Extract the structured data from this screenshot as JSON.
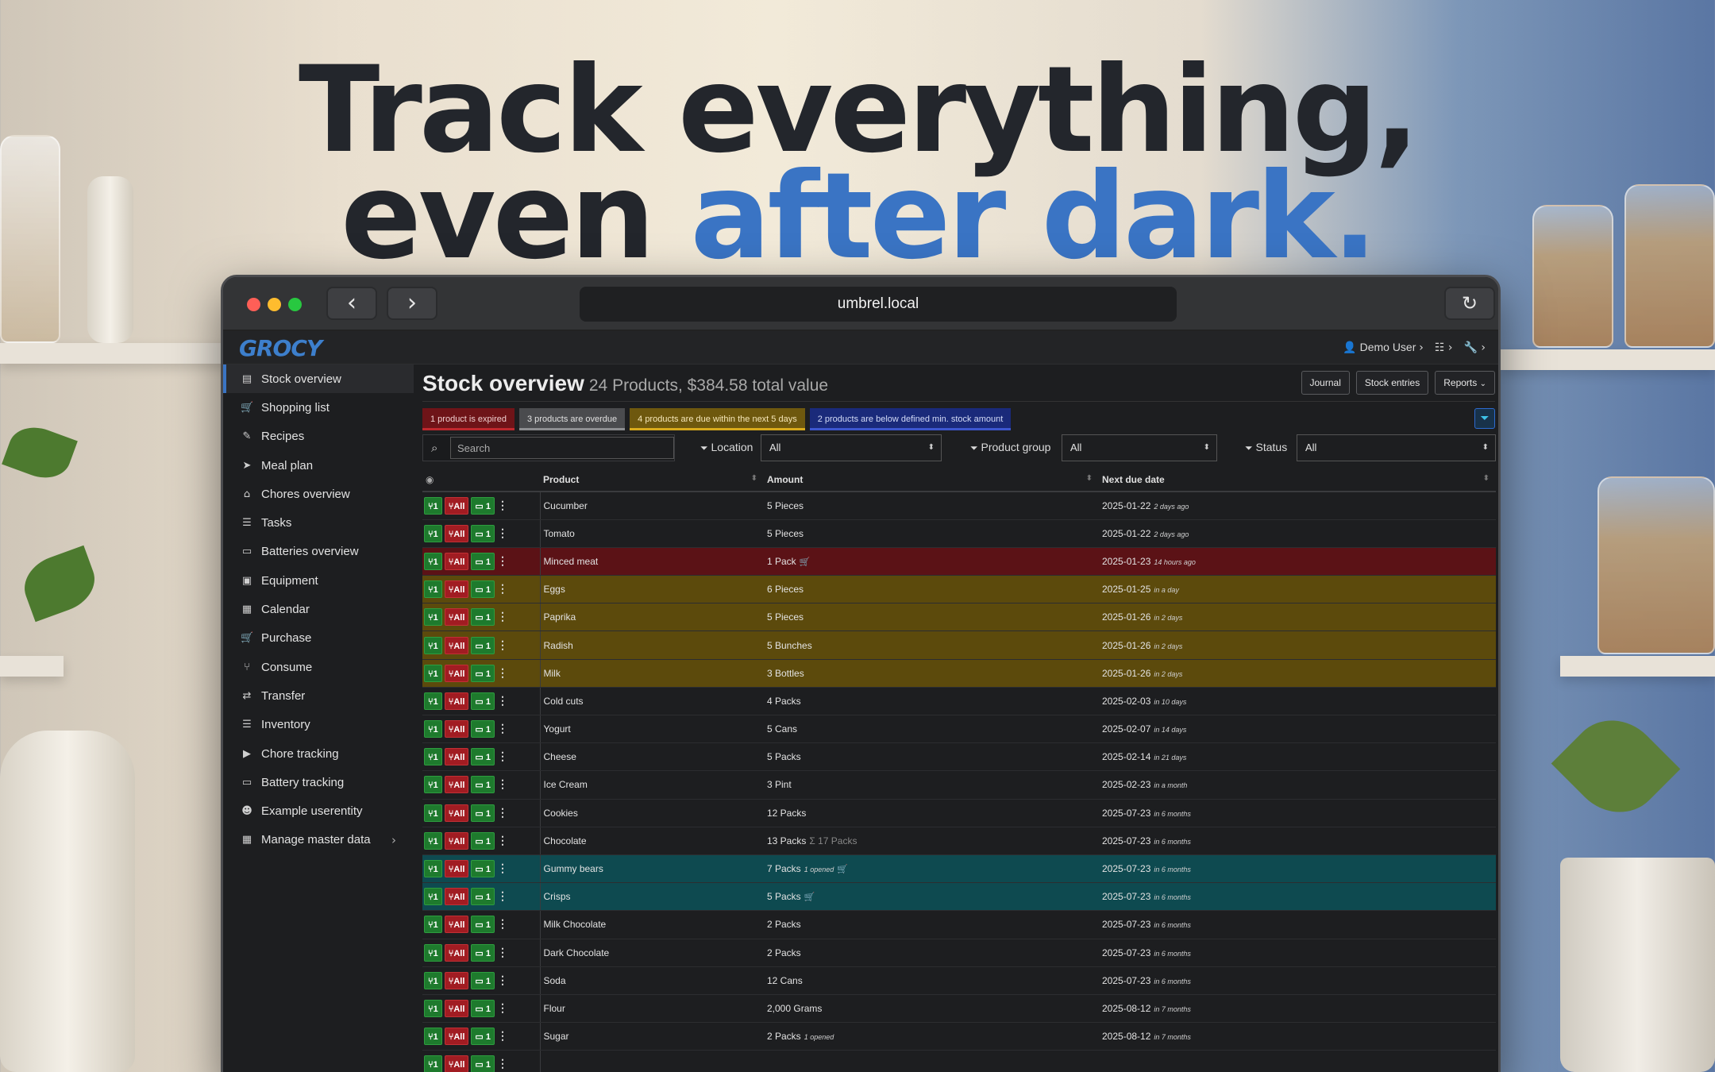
{
  "hero": {
    "line1": "Track everything,",
    "line2_prefix": "even ",
    "line2_accent": "after dark."
  },
  "browser": {
    "url": "umbrel.local",
    "back_icon": "chevron-left-icon",
    "forward_icon": "chevron-right-icon",
    "reload_icon": "reload-icon"
  },
  "app": {
    "logo": "GROCY",
    "user": "Demo User",
    "title": "Stock overview",
    "subtitle": "24 Products, $384.58 total value",
    "buttons": {
      "journal": "Journal",
      "stock_entries": "Stock entries",
      "reports": "Reports"
    }
  },
  "sidebar": {
    "items": [
      {
        "label": "Stock overview",
        "icon": "▤"
      },
      {
        "label": "Shopping list",
        "icon": "🛒"
      },
      {
        "label": "Recipes",
        "icon": "✎"
      },
      {
        "label": "Meal plan",
        "icon": "➤"
      },
      {
        "label": "Chores overview",
        "icon": "⌂"
      },
      {
        "label": "Tasks",
        "icon": "☰"
      },
      {
        "label": "Batteries overview",
        "icon": "▭"
      },
      {
        "label": "Equipment",
        "icon": "▣"
      },
      {
        "label": "Calendar",
        "icon": "▦"
      },
      {
        "label": "Purchase",
        "icon": "🛒"
      },
      {
        "label": "Consume",
        "icon": "⑂"
      },
      {
        "label": "Transfer",
        "icon": "⇄"
      },
      {
        "label": "Inventory",
        "icon": "☰"
      },
      {
        "label": "Chore tracking",
        "icon": "▶"
      },
      {
        "label": "Battery tracking",
        "icon": "▭"
      },
      {
        "label": "Example userentity",
        "icon": "☻"
      },
      {
        "label": "Manage master data",
        "icon": "▦"
      }
    ]
  },
  "alerts": {
    "expired": "1 product is expired",
    "overdue": "3 products are overdue",
    "due_soon": "4 products are due within the next 5 days",
    "below_min": "2 products are below defined min. stock amount"
  },
  "filters": {
    "search_placeholder": "Search",
    "location_label": "Location",
    "location_value": "All",
    "group_label": "Product group",
    "group_value": "All",
    "status_label": "Status",
    "status_value": "All"
  },
  "table": {
    "headers": {
      "product": "Product",
      "amount": "Amount",
      "next_due": "Next due date"
    },
    "action_labels": {
      "consume_one": "1",
      "consume_all": "All",
      "open_one": "1"
    },
    "rows": [
      {
        "product": "Cucumber",
        "amount": "5 Pieces",
        "amount_note": "",
        "opened": "",
        "cart": false,
        "date": "2025-01-22",
        "rel": "2 days ago",
        "status": ""
      },
      {
        "product": "Tomato",
        "amount": "5 Pieces",
        "amount_note": "",
        "opened": "",
        "cart": false,
        "date": "2025-01-22",
        "rel": "2 days ago",
        "status": ""
      },
      {
        "product": "Minced meat",
        "amount": "1 Pack",
        "amount_note": "",
        "opened": "",
        "cart": true,
        "date": "2025-01-23",
        "rel": "14 hours ago",
        "status": "expired"
      },
      {
        "product": "Eggs",
        "amount": "6 Pieces",
        "amount_note": "",
        "opened": "",
        "cart": false,
        "date": "2025-01-25",
        "rel": "in a day",
        "status": "due"
      },
      {
        "product": "Paprika",
        "amount": "5 Pieces",
        "amount_note": "",
        "opened": "",
        "cart": false,
        "date": "2025-01-26",
        "rel": "in 2 days",
        "status": "due"
      },
      {
        "product": "Radish",
        "amount": "5 Bunches",
        "amount_note": "",
        "opened": "",
        "cart": false,
        "date": "2025-01-26",
        "rel": "in 2 days",
        "status": "due"
      },
      {
        "product": "Milk",
        "amount": "3 Bottles",
        "amount_note": "",
        "opened": "",
        "cart": false,
        "date": "2025-01-26",
        "rel": "in 2 days",
        "status": "due"
      },
      {
        "product": "Cold cuts",
        "amount": "4 Packs",
        "amount_note": "",
        "opened": "",
        "cart": false,
        "date": "2025-02-03",
        "rel": "in 10 days",
        "status": ""
      },
      {
        "product": "Yogurt",
        "amount": "5 Cans",
        "amount_note": "",
        "opened": "",
        "cart": false,
        "date": "2025-02-07",
        "rel": "in 14 days",
        "status": ""
      },
      {
        "product": "Cheese",
        "amount": "5 Packs",
        "amount_note": "",
        "opened": "",
        "cart": false,
        "date": "2025-02-14",
        "rel": "in 21 days",
        "status": ""
      },
      {
        "product": "Ice Cream",
        "amount": "3 Pint",
        "amount_note": "",
        "opened": "",
        "cart": false,
        "date": "2025-02-23",
        "rel": "in a month",
        "status": ""
      },
      {
        "product": "Cookies",
        "amount": "12 Packs",
        "amount_note": "",
        "opened": "",
        "cart": false,
        "date": "2025-07-23",
        "rel": "in 6 months",
        "status": ""
      },
      {
        "product": "Chocolate",
        "amount": "13 Packs",
        "amount_note": "Σ 17 Packs",
        "opened": "",
        "cart": false,
        "date": "2025-07-23",
        "rel": "in 6 months",
        "status": ""
      },
      {
        "product": "Gummy bears",
        "amount": "7 Packs",
        "amount_note": "",
        "opened": "1 opened",
        "cart": true,
        "date": "2025-07-23",
        "rel": "in 6 months",
        "status": "below"
      },
      {
        "product": "Crisps",
        "amount": "5 Packs",
        "amount_note": "",
        "opened": "",
        "cart": true,
        "date": "2025-07-23",
        "rel": "in 6 months",
        "status": "below"
      },
      {
        "product": "Milk Chocolate",
        "amount": "2 Packs",
        "amount_note": "",
        "opened": "",
        "cart": false,
        "date": "2025-07-23",
        "rel": "in 6 months",
        "status": ""
      },
      {
        "product": "Dark Chocolate",
        "amount": "2 Packs",
        "amount_note": "",
        "opened": "",
        "cart": false,
        "date": "2025-07-23",
        "rel": "in 6 months",
        "status": ""
      },
      {
        "product": "Soda",
        "amount": "12 Cans",
        "amount_note": "",
        "opened": "",
        "cart": false,
        "date": "2025-07-23",
        "rel": "in 6 months",
        "status": ""
      },
      {
        "product": "Flour",
        "amount": "2,000 Grams",
        "amount_note": "",
        "opened": "",
        "cart": false,
        "date": "2025-08-12",
        "rel": "in 7 months",
        "status": ""
      },
      {
        "product": "Sugar",
        "amount": "2 Packs",
        "amount_note": "",
        "opened": "1 opened",
        "cart": false,
        "date": "2025-08-12",
        "rel": "in 7 months",
        "status": ""
      },
      {
        "product": "",
        "amount": "",
        "amount_note": "",
        "opened": "",
        "cart": false,
        "date": "",
        "rel": "",
        "status": ""
      }
    ]
  },
  "colors": {
    "accent": "#3a74c4",
    "expired": "#5b1216",
    "due": "#5c4a0c",
    "below_min": "#0e4a50"
  }
}
